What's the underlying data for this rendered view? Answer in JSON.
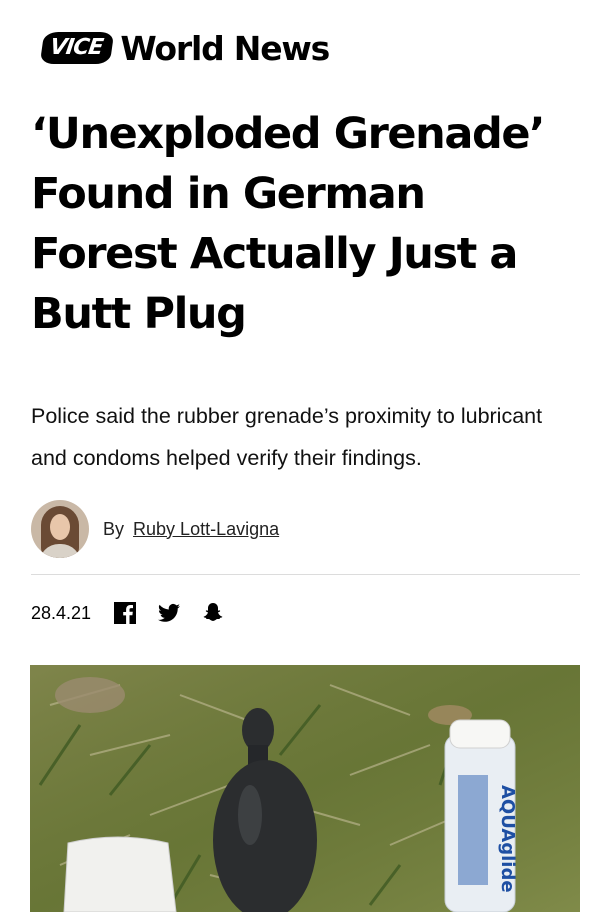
{
  "header": {
    "logo_text": "VICE",
    "section_title": "World News"
  },
  "article": {
    "headline": "‘Unexploded Grenade’ Found in German Forest Actually Just a Butt Plug",
    "dek": "Police said the rubber grenade’s proximity to lubricant and condoms helped verify their findings.",
    "byline_prefix": "By",
    "author": "Ruby Lott-Lavigna",
    "date": "28.4.21"
  },
  "share": {
    "icons": [
      "facebook-icon",
      "twitter-icon",
      "snapchat-icon"
    ]
  },
  "photo": {
    "bottle_label": "AQUAglide"
  },
  "colors": {
    "text": "#000000",
    "divider": "#dcdcdc",
    "grass": "#6f7d3c",
    "plug": "#2b2d2f"
  }
}
